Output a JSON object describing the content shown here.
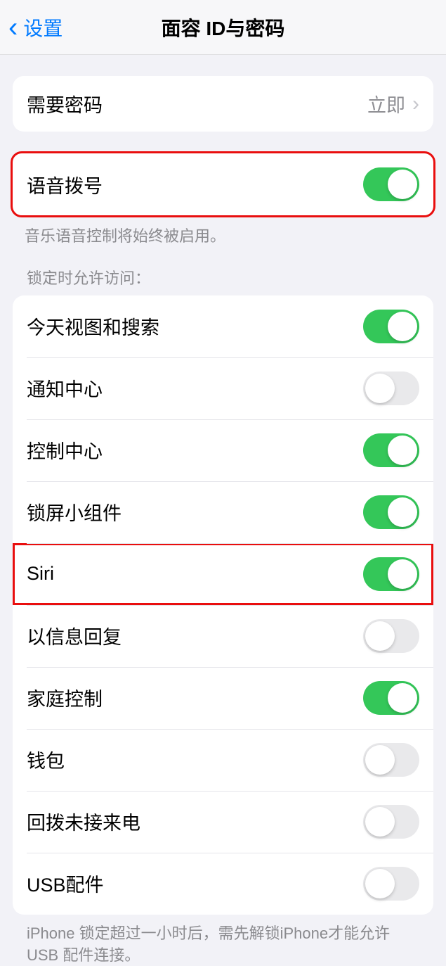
{
  "nav": {
    "back": "设置",
    "title": "面容 ID与密码"
  },
  "passcode": {
    "label": "需要密码",
    "value": "立即"
  },
  "voice": {
    "label": "语音拨号",
    "on": true,
    "footer": "音乐语音控制将始终被启用。"
  },
  "locked_header": "锁定时允许访问：",
  "locked_items": [
    {
      "label": "今天视图和搜索",
      "on": true
    },
    {
      "label": "通知中心",
      "on": false
    },
    {
      "label": "控制中心",
      "on": true
    },
    {
      "label": "锁屏小组件",
      "on": true
    },
    {
      "label": "Siri",
      "on": true
    },
    {
      "label": "以信息回复",
      "on": false
    },
    {
      "label": "家庭控制",
      "on": true
    },
    {
      "label": "钱包",
      "on": false
    },
    {
      "label": "回拨未接来电",
      "on": false
    },
    {
      "label": "USB配件",
      "on": false
    }
  ],
  "usb_footer": "iPhone 锁定超过一小时后，需先解锁iPhone才能允许 USB 配件连接。"
}
